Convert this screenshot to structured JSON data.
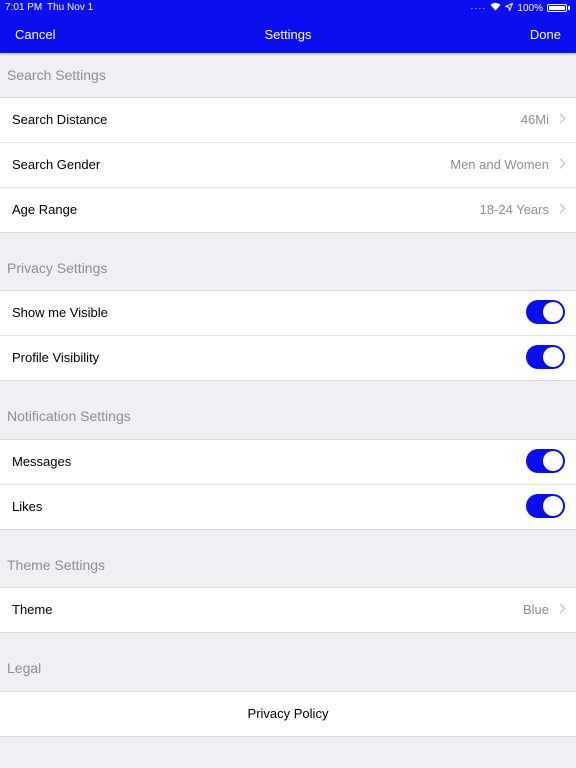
{
  "status_bar": {
    "time": "7:01 PM",
    "date": "Thu Nov 1",
    "battery": "100%"
  },
  "nav": {
    "cancel_label": "Cancel",
    "title": "Settings",
    "done_label": "Done"
  },
  "search_settings": {
    "header": "Search Settings",
    "distance_label": "Search Distance",
    "distance_value": "46Mi",
    "gender_label": "Search Gender",
    "gender_value": "Men and Women",
    "age_label": "Age Range",
    "age_value": "18-24 Years"
  },
  "privacy_settings": {
    "header": "Privacy Settings",
    "visible_label": "Show me Visible",
    "visible_on": true,
    "profile_label": "Profile Visibility",
    "profile_on": true
  },
  "notification_settings": {
    "header": "Notification Settings",
    "messages_label": "Messages",
    "messages_on": true,
    "likes_label": "Likes",
    "likes_on": true
  },
  "theme_settings": {
    "header": "Theme Settings",
    "theme_label": "Theme",
    "theme_value": "Blue"
  },
  "legal": {
    "header": "Legal",
    "privacy_policy_label": "Privacy Policy"
  },
  "colors": {
    "accent": "#0a0ff0",
    "background": "#efeff4",
    "secondary_text": "#8e8e93"
  }
}
